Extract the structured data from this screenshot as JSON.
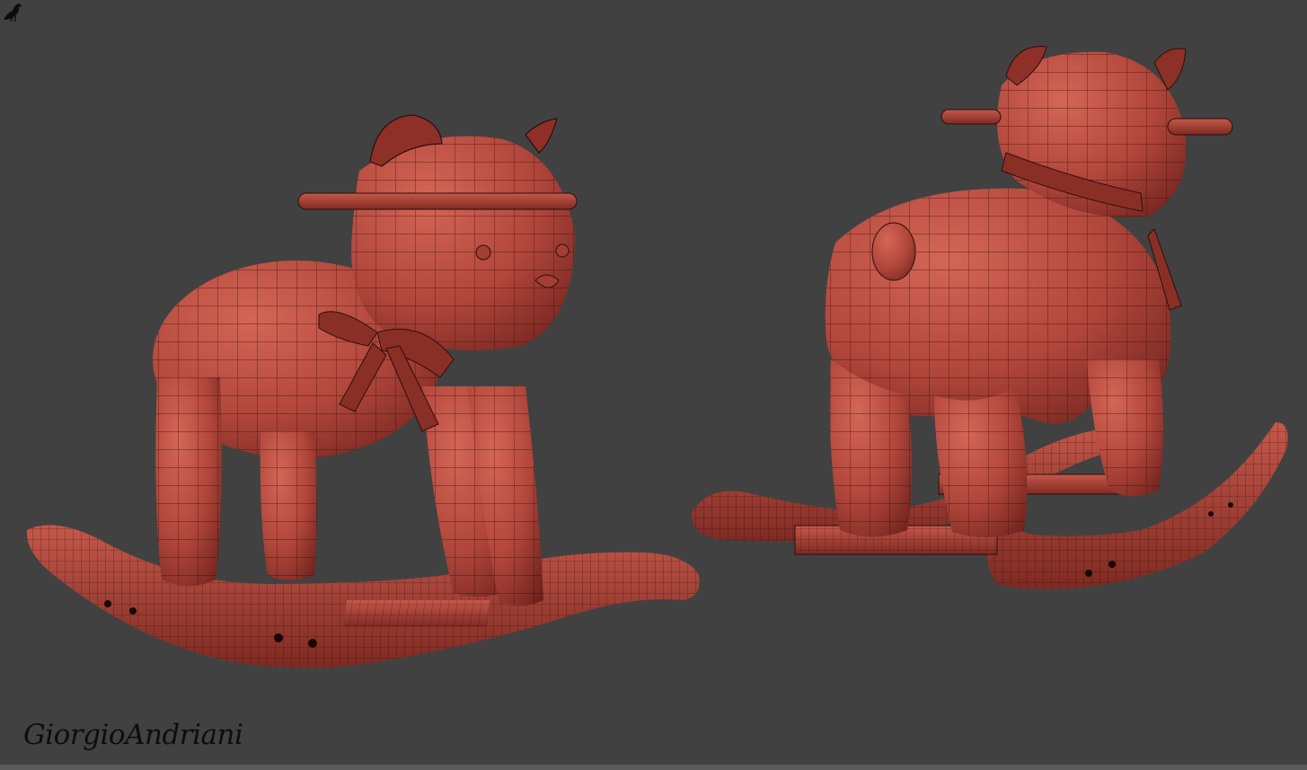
{
  "signature": {
    "text": "GiorgioAndriani"
  },
  "scene": {
    "background": "#414141",
    "model_fill": "#b8483c",
    "wire_color": "#2a0f0c",
    "icons": [
      "crow-icon"
    ]
  }
}
